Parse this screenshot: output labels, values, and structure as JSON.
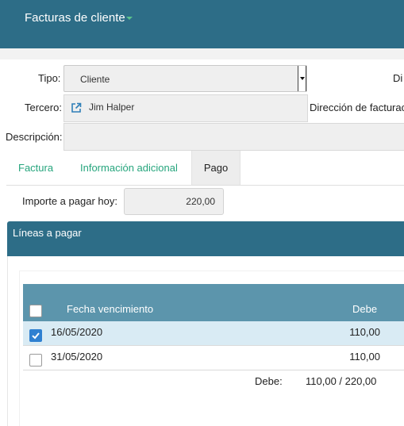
{
  "header": {
    "title": "Facturas de cliente"
  },
  "form": {
    "tipo_label": "Tipo:",
    "tipo_value": "Cliente",
    "di_label": "Di",
    "tercero_label": "Tercero:",
    "tercero_value": "Jim Halper",
    "direccion_label": "Dirección de facturac",
    "descripcion_label": "Descripción:"
  },
  "tabs": [
    {
      "label": "Factura",
      "active": false
    },
    {
      "label": "Información adicional",
      "active": false
    },
    {
      "label": "Pago",
      "active": true
    }
  ],
  "payment": {
    "importe_label": "Importe a pagar hoy:",
    "importe_value": "220,00"
  },
  "lines": {
    "panel_title": "Líneas a pagar",
    "columns": {
      "fecha": "Fecha vencimiento",
      "debe": "Debe"
    },
    "rows": [
      {
        "fecha": "16/05/2020",
        "debe": "110,00",
        "checked": true
      },
      {
        "fecha": "31/05/2020",
        "debe": "110,00",
        "checked": false
      }
    ],
    "total_label": "Debe:",
    "total_value": "110,00 / 220,00"
  },
  "colors": {
    "header": "#2d6d87",
    "table_header": "#5c95ac",
    "accent": "#26a57d",
    "selected_row": "#d9ebf4",
    "checkbox": "#2f80d1"
  },
  "icons": {
    "tercero_link": "external-link-icon",
    "title_caret": "caret-down-icon"
  }
}
